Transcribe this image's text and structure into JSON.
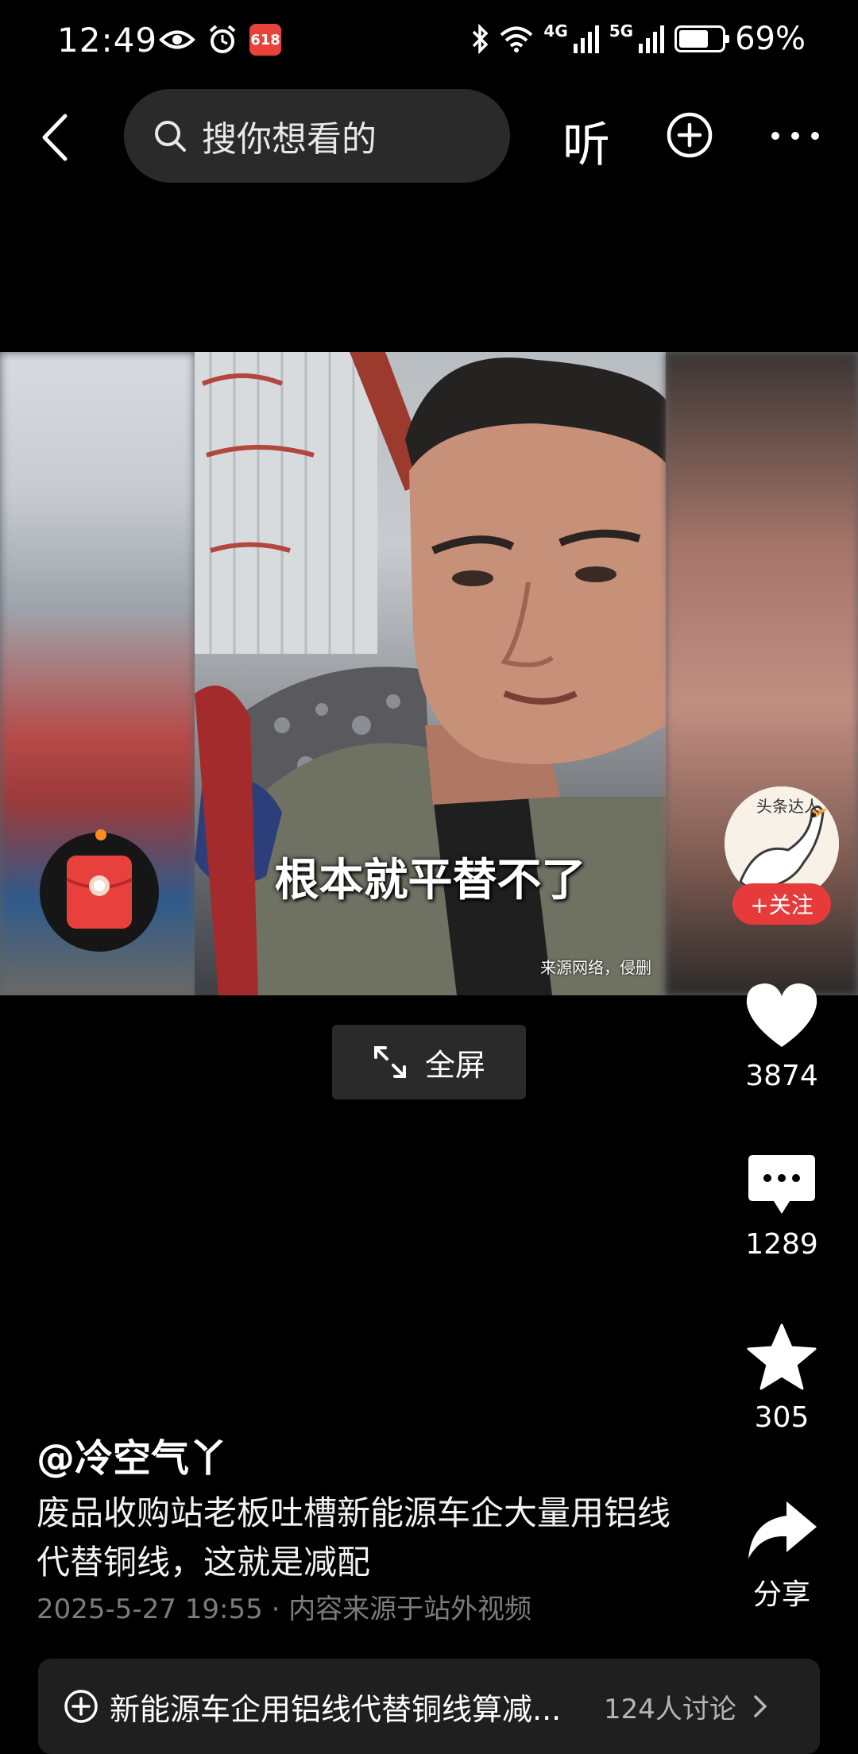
{
  "status_bar": {
    "time": "12:49",
    "battery": "69%",
    "battery_level": 0.69,
    "network_4g": "4G",
    "network_5g": "5G",
    "app_badge": "618",
    "icons": [
      "eye-icon",
      "alarm-icon",
      "app-badge-icon",
      "bluetooth-icon",
      "wifi-icon",
      "signal-4g-icon",
      "signal-5g-icon",
      "battery-icon"
    ]
  },
  "top_nav": {
    "search_placeholder": "搜你想看的",
    "listen_label": "听",
    "icons": [
      "back-icon",
      "search-icon",
      "plus-circle-icon",
      "more-dots-icon"
    ]
  },
  "video": {
    "subtitle": "根本就平替不了",
    "watermark": "来源网络，侵删"
  },
  "author_avatar": {
    "badge_text": "头条达人",
    "follow_label": "+关注"
  },
  "fullscreen": {
    "label": "全屏"
  },
  "actions": {
    "like_count": "3874",
    "comment_count": "1289",
    "favorite_count": "305",
    "share_label": "分享"
  },
  "post": {
    "author": "@冷空气丫",
    "description": "废品收购站老板吐槽新能源车企大量用铝线代替铜线，这就是减配",
    "timestamp": "2025-5-27 19:55",
    "separator": "·",
    "source": "内容来源于站外视频"
  },
  "topic": {
    "text": "新能源车企用铝线代替铜线算减...",
    "count": "124人讨论"
  },
  "colors": {
    "background": "#000000",
    "accent_red": "#e73b3b",
    "panel": "#2a2a2a"
  }
}
